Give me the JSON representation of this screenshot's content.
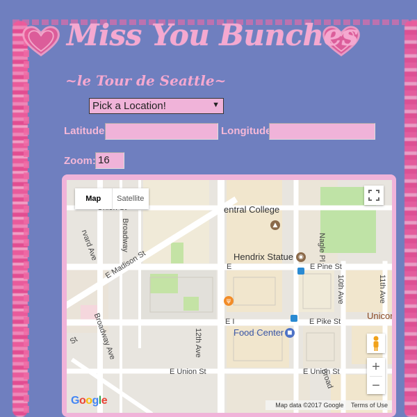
{
  "header": {
    "title": "Miss You Bunches",
    "subtitle": "~le Tour de Seattle~"
  },
  "form": {
    "location_select": {
      "value": "Pick a Location!"
    },
    "latitude": {
      "label": "Latitude:",
      "value": ""
    },
    "longitude": {
      "label": "Longitude:",
      "value": ""
    },
    "zoom": {
      "label": "Zoom:",
      "value": "16"
    }
  },
  "map": {
    "type_buttons": {
      "map": "Map",
      "satellite": "Satellite"
    },
    "zoom_in": "+",
    "zoom_out": "−",
    "attribution": {
      "data": "Map data ©2017 Google",
      "terms": "Terms of Use"
    },
    "logo": "Google",
    "pois": {
      "central_college": "entral College",
      "hendrix_statue": "Hendrix Statue",
      "food_center": "Food Center",
      "unicorn": "Unicor"
    },
    "streets": {
      "madison": "E Madison St",
      "pine": "E Pine St",
      "pike": "E Pike St",
      "union": "E Union St",
      "union2": "E Union St",
      "broadway": "Broadway",
      "broadway_ave": "Broadway Ave",
      "harvard": "rvard Ave",
      "twelfth": "12th Ave",
      "tenth": "10th Ave",
      "eleventh": "11th Ave",
      "nagle": "Nagle Pl",
      "pine_e": "E",
      "pike_e": "E I",
      "top_partial": "Union St",
      "st_left": "St",
      "broadway_right": "Broad"
    }
  },
  "colors": {
    "background": "#6f7fbf",
    "pink": "#f5a8d0",
    "field_bg": "#f0b3d9"
  }
}
